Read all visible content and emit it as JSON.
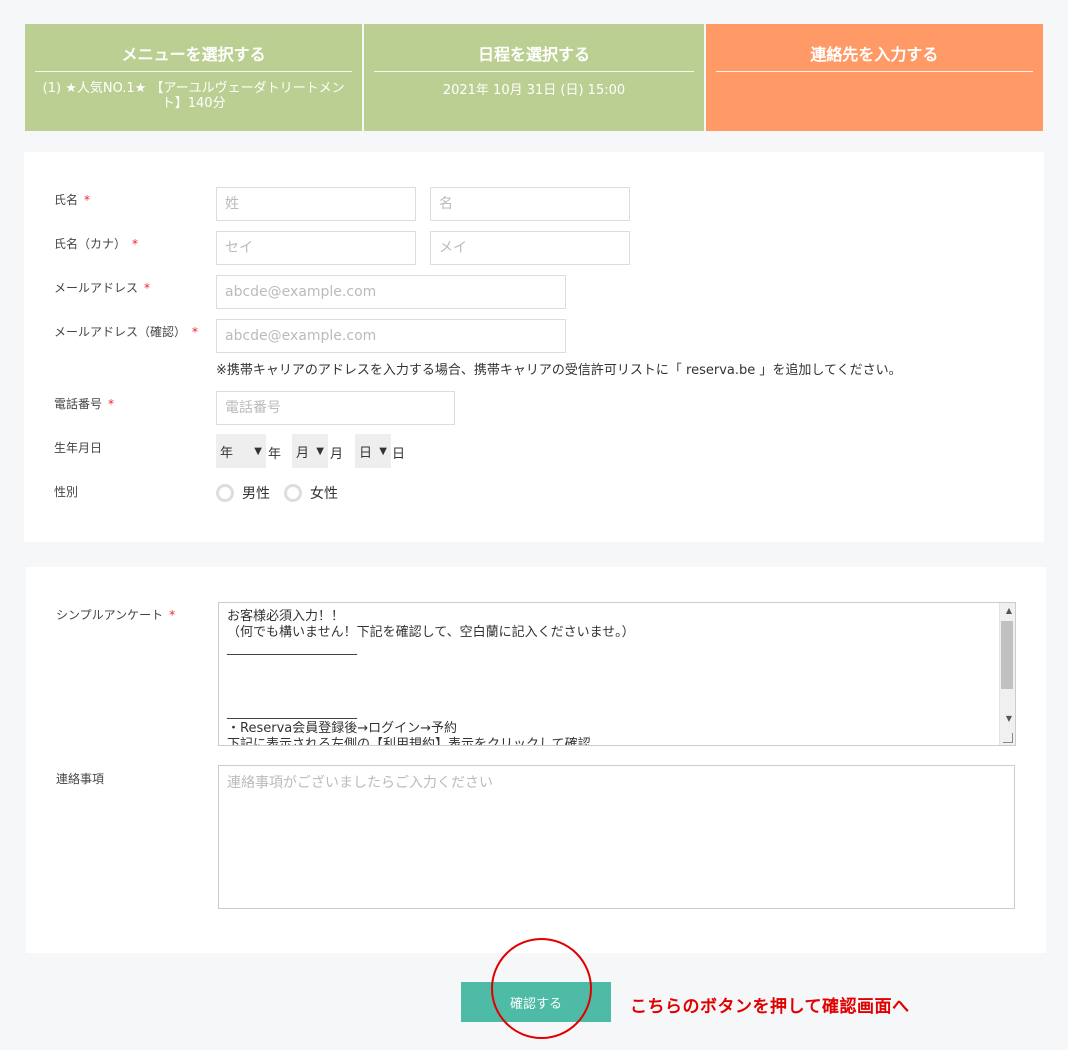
{
  "steps": [
    {
      "title": "メニューを選択する",
      "sub": "(1) ★人気NO.1★ 【アーユルヴェーダトリートメント】140分"
    },
    {
      "title": "日程を選択する",
      "sub": "2021年 10月 31日 (日) 15:00"
    },
    {
      "title": "連絡先を入力する",
      "sub": ""
    }
  ],
  "form": {
    "name": {
      "label": "氏名",
      "req": "*",
      "last_ph": "姓",
      "first_ph": "名"
    },
    "kana": {
      "label": "氏名（カナ）",
      "req": "*",
      "last_ph": "セイ",
      "first_ph": "メイ"
    },
    "email": {
      "label": "メールアドレス",
      "req": "*",
      "ph": "abcde@example.com"
    },
    "email_confirm": {
      "label": "メールアドレス（確認）",
      "req": "*",
      "ph": "abcde@example.com"
    },
    "carrier_note": "※携帯キャリアのアドレスを入力する場合、携帯キャリアの受信許可リストに「 reserva.be 」を追加してください。",
    "phone": {
      "label": "電話番号",
      "req": "*",
      "ph": "電話番号"
    },
    "birth": {
      "label": "生年月日",
      "year": "年",
      "year_unit": "年",
      "month": "月",
      "month_unit": "月",
      "day": "日",
      "day_unit": "日"
    },
    "gender": {
      "label": "性別",
      "male": "男性",
      "female": "女性"
    }
  },
  "survey": {
    "label": "シンプルアンケート",
    "req": "*",
    "text": "お客様必須入力！！\n（何でも構いません！下記を確認して、空白蘭に記入くださいませ。）\n____________________\n\n\n\n____________________\n・Reserva会員登録後→ログイン→予約\n下記に表示される左側の【利用規約】表示をクリックして確認"
  },
  "contact": {
    "label": "連絡事項",
    "ph": "連絡事項がございましたらご入力ください"
  },
  "confirm_label": "確認する",
  "hint": "こちらのボタンを押して確認画面へ",
  "colors": {
    "step_done": "#bccf92",
    "step_active": "#ff9966",
    "button": "#4dbba5",
    "annotation": "#e00000"
  }
}
